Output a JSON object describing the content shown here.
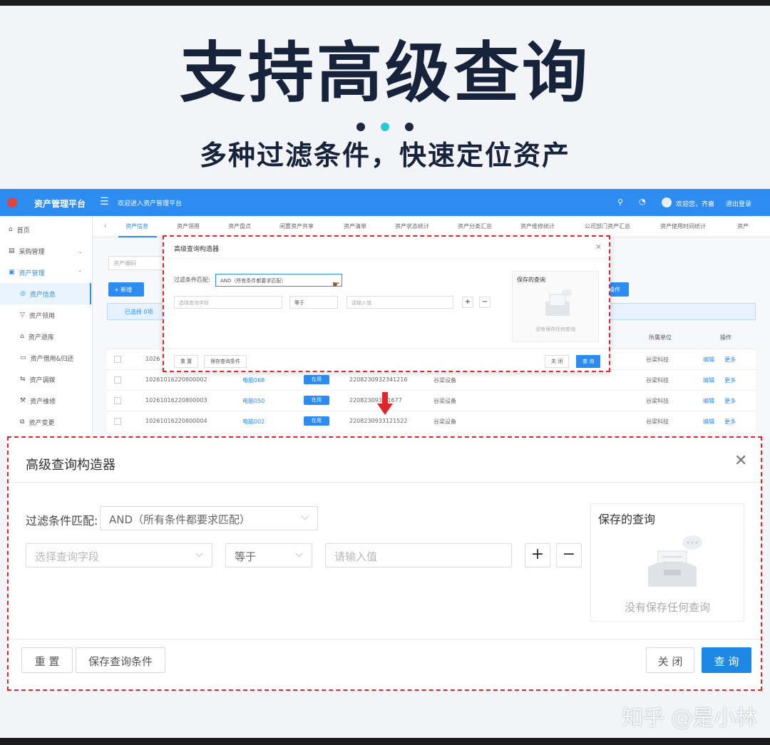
{
  "hero": {
    "title": "支持高级查询",
    "subtitle": "多种过滤条件，快速定位资产"
  },
  "colors": {
    "primary": "#2d8cf0",
    "highlight_border": "#e0262c",
    "title_text": "#16233a",
    "accent_dot": "#29c6d8"
  },
  "app": {
    "name": "资产管理平台",
    "welcome": "欢迎进入资产管理平台",
    "user": "欢迎您，齐嘉",
    "logout": "退出登录",
    "sidebar": [
      {
        "label": "首页",
        "icon": "home-icon"
      },
      {
        "label": "采购管理",
        "icon": "cart-icon"
      },
      {
        "label": "资产管理",
        "icon": "box-icon"
      },
      {
        "label": "资产信息",
        "icon": "info-icon"
      },
      {
        "label": "资产领用",
        "icon": "receive-icon"
      },
      {
        "label": "资产退库",
        "icon": "return-icon"
      },
      {
        "label": "资产借用&归还",
        "icon": "borrow-icon"
      },
      {
        "label": "资产调拨",
        "icon": "transfer-icon"
      },
      {
        "label": "资产维修",
        "icon": "wrench-icon"
      },
      {
        "label": "资产变更",
        "icon": "change-icon"
      }
    ],
    "tabs": [
      "资产信息",
      "资产领用",
      "资产盘点",
      "闲置资产共享",
      "资产清单",
      "资产状态统计",
      "资产分类汇总",
      "资产维修统计",
      "公司部门资产汇总",
      "资产使用时间统计",
      "资产"
    ],
    "search_placeholder": "资产编码",
    "add_button": "+ 新增",
    "right_button": "操作",
    "selected_text": "已选择 0项",
    "table_headers": {
      "unit": "所属单位",
      "ops": "操作"
    },
    "rows": [
      {
        "id": "1026",
        "name": "",
        "status": "",
        "sn": "",
        "category": "",
        "unit": "谷梁科技",
        "edit": "编辑",
        "more": "更多"
      },
      {
        "id": "10261016220800002",
        "name": "电脑068",
        "status": "在用",
        "sn": "2208230932341216",
        "category": "谷梁设备",
        "unit": "谷梁科技",
        "edit": "编辑",
        "more": "更多"
      },
      {
        "id": "10261016220800003",
        "name": "电脑050",
        "status": "在用",
        "sn": "220823093...1677",
        "category": "谷梁设备",
        "unit": "谷梁科技",
        "edit": "编辑",
        "more": "更多"
      },
      {
        "id": "10261016220800004",
        "name": "电脑002",
        "status": "在用",
        "sn": "2208230933121522",
        "category": "谷梁设备",
        "unit": "谷梁科技",
        "edit": "编辑",
        "more": "更多"
      }
    ]
  },
  "dialog": {
    "title": "高级查询构造器",
    "match_label": "过滤条件匹配:",
    "match_value": "AND（所有条件都要求匹配）",
    "field_placeholder": "选择查询字段",
    "operator": "等于",
    "value_placeholder": "请输入值",
    "plus": "+",
    "minus": "−",
    "saved_title": "保存的查询",
    "saved_empty": "没有保存任何查询",
    "reset": "重 置",
    "save_conditions": "保存查询条件",
    "close": "关 闭",
    "query": "查 询"
  },
  "watermark": "知乎 @是小林"
}
